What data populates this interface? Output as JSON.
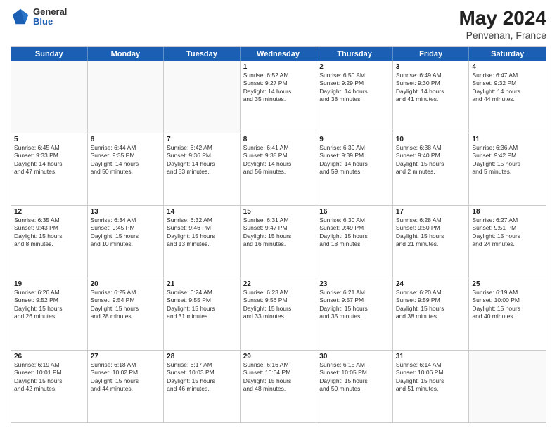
{
  "header": {
    "logo": {
      "general": "General",
      "blue": "Blue"
    },
    "title": "May 2024",
    "location": "Penvenan, France"
  },
  "weekdays": [
    "Sunday",
    "Monday",
    "Tuesday",
    "Wednesday",
    "Thursday",
    "Friday",
    "Saturday"
  ],
  "rows": [
    [
      {
        "day": "",
        "text": ""
      },
      {
        "day": "",
        "text": ""
      },
      {
        "day": "",
        "text": ""
      },
      {
        "day": "1",
        "text": "Sunrise: 6:52 AM\nSunset: 9:27 PM\nDaylight: 14 hours\nand 35 minutes."
      },
      {
        "day": "2",
        "text": "Sunrise: 6:50 AM\nSunset: 9:29 PM\nDaylight: 14 hours\nand 38 minutes."
      },
      {
        "day": "3",
        "text": "Sunrise: 6:49 AM\nSunset: 9:30 PM\nDaylight: 14 hours\nand 41 minutes."
      },
      {
        "day": "4",
        "text": "Sunrise: 6:47 AM\nSunset: 9:32 PM\nDaylight: 14 hours\nand 44 minutes."
      }
    ],
    [
      {
        "day": "5",
        "text": "Sunrise: 6:45 AM\nSunset: 9:33 PM\nDaylight: 14 hours\nand 47 minutes."
      },
      {
        "day": "6",
        "text": "Sunrise: 6:44 AM\nSunset: 9:35 PM\nDaylight: 14 hours\nand 50 minutes."
      },
      {
        "day": "7",
        "text": "Sunrise: 6:42 AM\nSunset: 9:36 PM\nDaylight: 14 hours\nand 53 minutes."
      },
      {
        "day": "8",
        "text": "Sunrise: 6:41 AM\nSunset: 9:38 PM\nDaylight: 14 hours\nand 56 minutes."
      },
      {
        "day": "9",
        "text": "Sunrise: 6:39 AM\nSunset: 9:39 PM\nDaylight: 14 hours\nand 59 minutes."
      },
      {
        "day": "10",
        "text": "Sunrise: 6:38 AM\nSunset: 9:40 PM\nDaylight: 15 hours\nand 2 minutes."
      },
      {
        "day": "11",
        "text": "Sunrise: 6:36 AM\nSunset: 9:42 PM\nDaylight: 15 hours\nand 5 minutes."
      }
    ],
    [
      {
        "day": "12",
        "text": "Sunrise: 6:35 AM\nSunset: 9:43 PM\nDaylight: 15 hours\nand 8 minutes."
      },
      {
        "day": "13",
        "text": "Sunrise: 6:34 AM\nSunset: 9:45 PM\nDaylight: 15 hours\nand 10 minutes."
      },
      {
        "day": "14",
        "text": "Sunrise: 6:32 AM\nSunset: 9:46 PM\nDaylight: 15 hours\nand 13 minutes."
      },
      {
        "day": "15",
        "text": "Sunrise: 6:31 AM\nSunset: 9:47 PM\nDaylight: 15 hours\nand 16 minutes."
      },
      {
        "day": "16",
        "text": "Sunrise: 6:30 AM\nSunset: 9:49 PM\nDaylight: 15 hours\nand 18 minutes."
      },
      {
        "day": "17",
        "text": "Sunrise: 6:28 AM\nSunset: 9:50 PM\nDaylight: 15 hours\nand 21 minutes."
      },
      {
        "day": "18",
        "text": "Sunrise: 6:27 AM\nSunset: 9:51 PM\nDaylight: 15 hours\nand 24 minutes."
      }
    ],
    [
      {
        "day": "19",
        "text": "Sunrise: 6:26 AM\nSunset: 9:52 PM\nDaylight: 15 hours\nand 26 minutes."
      },
      {
        "day": "20",
        "text": "Sunrise: 6:25 AM\nSunset: 9:54 PM\nDaylight: 15 hours\nand 28 minutes."
      },
      {
        "day": "21",
        "text": "Sunrise: 6:24 AM\nSunset: 9:55 PM\nDaylight: 15 hours\nand 31 minutes."
      },
      {
        "day": "22",
        "text": "Sunrise: 6:23 AM\nSunset: 9:56 PM\nDaylight: 15 hours\nand 33 minutes."
      },
      {
        "day": "23",
        "text": "Sunrise: 6:21 AM\nSunset: 9:57 PM\nDaylight: 15 hours\nand 35 minutes."
      },
      {
        "day": "24",
        "text": "Sunrise: 6:20 AM\nSunset: 9:59 PM\nDaylight: 15 hours\nand 38 minutes."
      },
      {
        "day": "25",
        "text": "Sunrise: 6:19 AM\nSunset: 10:00 PM\nDaylight: 15 hours\nand 40 minutes."
      }
    ],
    [
      {
        "day": "26",
        "text": "Sunrise: 6:19 AM\nSunset: 10:01 PM\nDaylight: 15 hours\nand 42 minutes."
      },
      {
        "day": "27",
        "text": "Sunrise: 6:18 AM\nSunset: 10:02 PM\nDaylight: 15 hours\nand 44 minutes."
      },
      {
        "day": "28",
        "text": "Sunrise: 6:17 AM\nSunset: 10:03 PM\nDaylight: 15 hours\nand 46 minutes."
      },
      {
        "day": "29",
        "text": "Sunrise: 6:16 AM\nSunset: 10:04 PM\nDaylight: 15 hours\nand 48 minutes."
      },
      {
        "day": "30",
        "text": "Sunrise: 6:15 AM\nSunset: 10:05 PM\nDaylight: 15 hours\nand 50 minutes."
      },
      {
        "day": "31",
        "text": "Sunrise: 6:14 AM\nSunset: 10:06 PM\nDaylight: 15 hours\nand 51 minutes."
      },
      {
        "day": "",
        "text": ""
      }
    ]
  ]
}
